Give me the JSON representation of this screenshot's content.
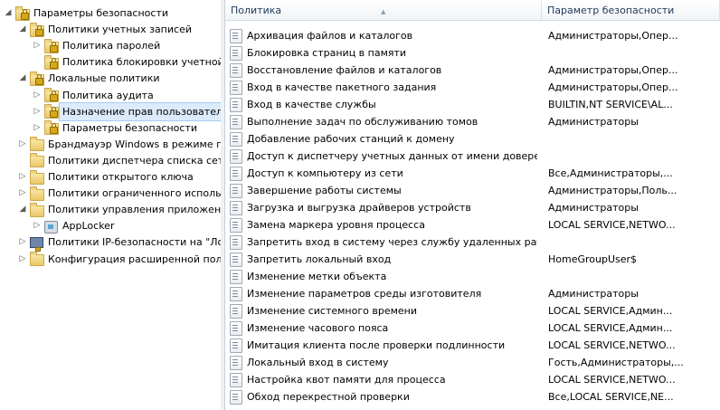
{
  "tree": [
    {
      "label": "Параметры безопасности",
      "level": 0,
      "expander": "◢",
      "icon": "security-settings-icon",
      "name": "tree-item-security-settings"
    },
    {
      "label": "Политики учетных записей",
      "level": 1,
      "expander": "◢",
      "icon": "folder-lock-icon",
      "name": "tree-item-account-policies"
    },
    {
      "label": "Политика паролей",
      "level": 2,
      "expander": "▷",
      "icon": "folder-lock-icon",
      "name": "tree-item-password-policy"
    },
    {
      "label": "Политика блокировки учетной з",
      "level": 2,
      "expander": "",
      "icon": "folder-lock-icon",
      "name": "tree-item-lockout-policy"
    },
    {
      "label": "Локальные политики",
      "level": 1,
      "expander": "◢",
      "icon": "folder-lock-icon",
      "name": "tree-item-local-policies"
    },
    {
      "label": "Политика аудита",
      "level": 2,
      "expander": "▷",
      "icon": "folder-lock-icon",
      "name": "tree-item-audit-policy"
    },
    {
      "label": "Назначение прав пользователя",
      "level": 2,
      "expander": "▷",
      "icon": "folder-lock-icon",
      "name": "tree-item-user-rights",
      "selected": true
    },
    {
      "label": "Параметры безопасности",
      "level": 2,
      "expander": "▷",
      "icon": "folder-lock-icon",
      "name": "tree-item-security-options"
    },
    {
      "label": "Брандмауэр Windows в режиме пов",
      "level": 1,
      "expander": "▷",
      "icon": "folder-icon",
      "name": "tree-item-firewall"
    },
    {
      "label": "Политики диспетчера списка сетей",
      "level": 1,
      "expander": "",
      "icon": "folder-icon",
      "name": "tree-item-network-list"
    },
    {
      "label": "Политики открытого ключа",
      "level": 1,
      "expander": "▷",
      "icon": "folder-icon",
      "name": "tree-item-public-key"
    },
    {
      "label": "Политики ограниченного использо",
      "level": 1,
      "expander": "▷",
      "icon": "folder-icon",
      "name": "tree-item-software-restriction"
    },
    {
      "label": "Политики управления приложения",
      "level": 1,
      "expander": "◢",
      "icon": "folder-icon",
      "name": "tree-item-app-control"
    },
    {
      "label": "AppLocker",
      "level": 2,
      "expander": "▷",
      "icon": "applocker-icon",
      "name": "tree-item-applocker"
    },
    {
      "label": "Политики IP-безопасности на \"Лока",
      "level": 1,
      "expander": "▷",
      "icon": "ip-security-icon",
      "name": "tree-item-ipsec"
    },
    {
      "label": "Конфигурация расширенной полит",
      "level": 1,
      "expander": "▷",
      "icon": "folder-icon",
      "name": "tree-item-advanced-audit"
    }
  ],
  "columns": {
    "policy": "Политика",
    "setting": "Параметр безопасности",
    "sort_glyph": "▲"
  },
  "rows": [
    {
      "policy": "Архивация файлов и каталогов",
      "setting": "Администраторы,Опер..."
    },
    {
      "policy": "Блокировка страниц в памяти",
      "setting": ""
    },
    {
      "policy": "Восстановление файлов и каталогов",
      "setting": "Администраторы,Опер..."
    },
    {
      "policy": "Вход в качестве пакетного задания",
      "setting": "Администраторы,Опер..."
    },
    {
      "policy": "Вход в качестве службы",
      "setting": "BUILTIN,NT SERVICE\\AL..."
    },
    {
      "policy": "Выполнение задач по обслуживанию томов",
      "setting": "Администраторы"
    },
    {
      "policy": "Добавление рабочих станций к домену",
      "setting": ""
    },
    {
      "policy": "Доступ к диспетчеру учетных данных от имени доверенн...",
      "setting": ""
    },
    {
      "policy": "Доступ к компьютеру из сети",
      "setting": "Все,Администраторы,..."
    },
    {
      "policy": "Завершение работы системы",
      "setting": "Администраторы,Поль..."
    },
    {
      "policy": "Загрузка и выгрузка драйверов устройств",
      "setting": "Администраторы"
    },
    {
      "policy": "Замена маркера уровня процесса",
      "setting": "LOCAL SERVICE,NETWO..."
    },
    {
      "policy": "Запретить вход в систему через службу удаленных рабоч...",
      "setting": ""
    },
    {
      "policy": "Запретить локальный вход",
      "setting": "HomeGroupUser$"
    },
    {
      "policy": "Изменение метки объекта",
      "setting": ""
    },
    {
      "policy": "Изменение параметров среды изготовителя",
      "setting": "Администраторы"
    },
    {
      "policy": "Изменение системного времени",
      "setting": "LOCAL SERVICE,Админ..."
    },
    {
      "policy": "Изменение часового пояса",
      "setting": "LOCAL SERVICE,Админ..."
    },
    {
      "policy": "Имитация клиента после проверки подлинности",
      "setting": "LOCAL SERVICE,NETWO..."
    },
    {
      "policy": "Локальный вход в систему",
      "setting": "Гость,Администраторы,..."
    },
    {
      "policy": "Настройка квот памяти для процесса",
      "setting": "LOCAL SERVICE,NETWO..."
    },
    {
      "policy": "Обход перекрестной проверки",
      "setting": "Все,LOCAL SERVICE,NE..."
    }
  ]
}
